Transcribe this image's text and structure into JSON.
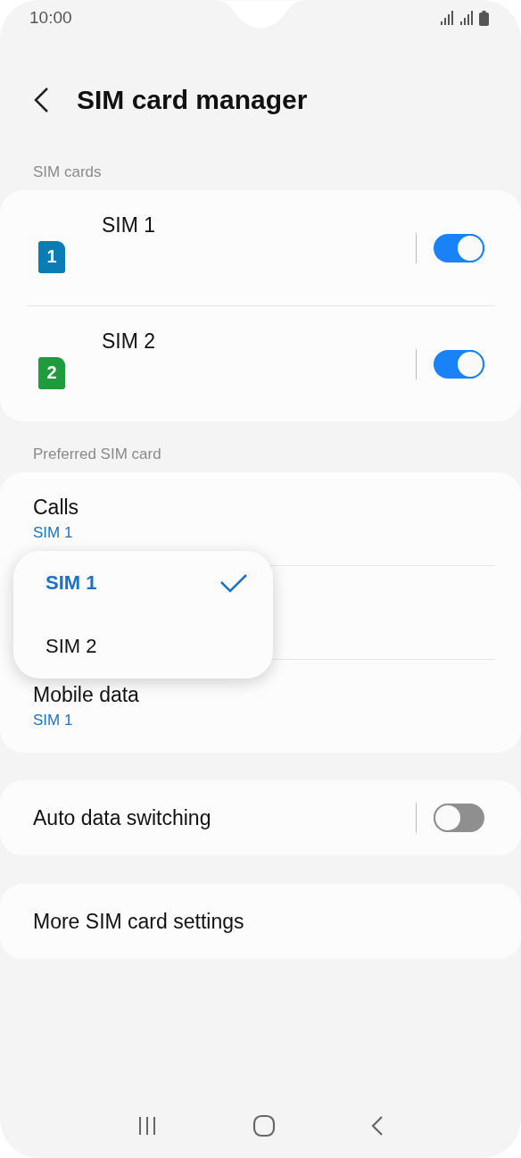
{
  "status_bar": {
    "time": "10:00"
  },
  "header": {
    "title": "SIM card manager"
  },
  "sim_section": {
    "heading": "SIM cards",
    "items": [
      {
        "name": "SIM 1",
        "badge": "1",
        "color": "#0b7db5",
        "on": true
      },
      {
        "name": "SIM 2",
        "badge": "2",
        "color": "#1f9a3c",
        "on": true
      }
    ]
  },
  "preferred_section": {
    "heading": "Preferred SIM card",
    "items": [
      {
        "title": "Calls",
        "value": "SIM 1"
      },
      {
        "title": "Mobile data",
        "value": "SIM 1"
      }
    ],
    "popup": {
      "options": [
        {
          "label": "SIM 1",
          "selected": true
        },
        {
          "label": "SIM 2",
          "selected": false
        }
      ]
    }
  },
  "auto_switch": {
    "label": "Auto data switching",
    "on": false
  },
  "more_settings": {
    "label": "More SIM card settings"
  }
}
